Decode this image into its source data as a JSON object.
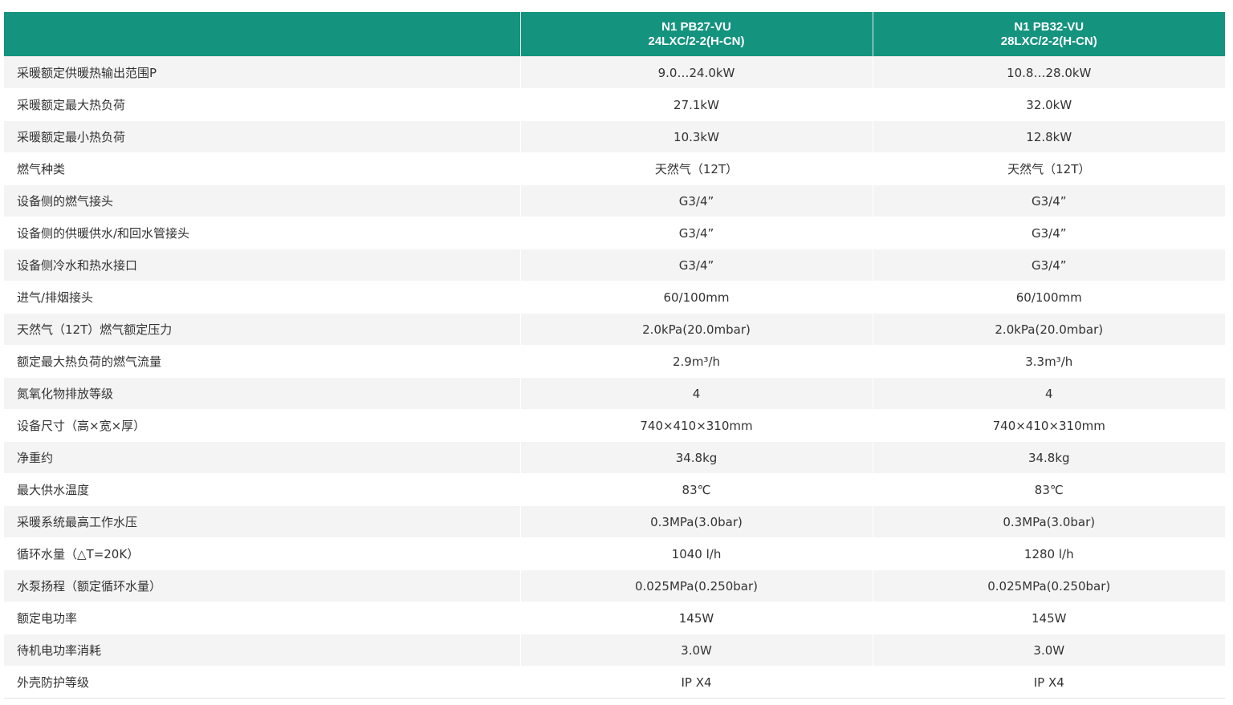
{
  "table": {
    "header": [
      "",
      {
        "line1": "N1 PB27-VU",
        "line2": "24LXC/2-2(H-CN)"
      },
      {
        "line1": "N1 PB32-VU",
        "line2": "28LXC/2-2(H-CN)"
      }
    ],
    "rows": [
      {
        "label": "采暖额定供暖热输出范围P",
        "v1": "9.0…24.0kW",
        "v2": "10.8…28.0kW"
      },
      {
        "label": "采暖额定最大热负荷",
        "v1": "27.1kW",
        "v2": "32.0kW"
      },
      {
        "label": "采暖额定最小热负荷",
        "v1": "10.3kW",
        "v2": "12.8kW"
      },
      {
        "label": "燃气种类",
        "v1": "天然气（12T）",
        "v2": "天然气（12T）"
      },
      {
        "label": "设备侧的燃气接头",
        "v1": "G3/4”",
        "v2": "G3/4”"
      },
      {
        "label": "设备侧的供暖供水/和回水管接头",
        "v1": "G3/4”",
        "v2": "G3/4”"
      },
      {
        "label": "设备侧冷水和热水接口",
        "v1": "G3/4”",
        "v2": "G3/4”"
      },
      {
        "label": "进气/排烟接头",
        "v1": "60/100mm",
        "v2": "60/100mm"
      },
      {
        "label": "天然气（12T）燃气额定压力",
        "v1": "2.0kPa(20.0mbar)",
        "v2": "2.0kPa(20.0mbar)"
      },
      {
        "label": "额定最大热负荷的燃气流量",
        "v1": "2.9m³/h",
        "v2": "3.3m³/h"
      },
      {
        "label": "氮氧化物排放等级",
        "v1": "4",
        "v2": "4"
      },
      {
        "label": "设备尺寸（高×宽×厚）",
        "v1": "740×410×310mm",
        "v2": "740×410×310mm"
      },
      {
        "label": "净重约",
        "v1": "34.8kg",
        "v2": "34.8kg"
      },
      {
        "label": "最大供水温度",
        "v1": "83℃",
        "v2": "83℃"
      },
      {
        "label": "采暖系统最高工作水压",
        "v1": "0.3MPa(3.0bar)",
        "v2": "0.3MPa(3.0bar)"
      },
      {
        "label": "循环水量（△T=20K）",
        "v1": "1040 l/h",
        "v2": "1280 l/h"
      },
      {
        "label": "水泵扬程（额定循环水量）",
        "v1": "0.025MPa(0.250bar)",
        "v2": "0.025MPa(0.250bar)"
      },
      {
        "label": "额定电功率",
        "v1": "145W",
        "v2": "145W"
      },
      {
        "label": "待机电功率消耗",
        "v1": "3.0W",
        "v2": "3.0W"
      },
      {
        "label": "外壳防护等级",
        "v1": "IP X4",
        "v2": "IP X4"
      }
    ]
  },
  "colors": {
    "header_bg": "#14937f",
    "header_text": "#ffffff",
    "row_alt_bg": "#f4f4f4",
    "text": "#333333"
  }
}
